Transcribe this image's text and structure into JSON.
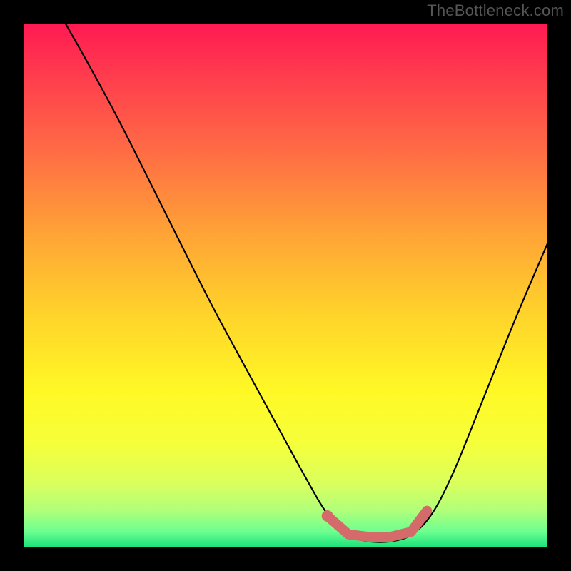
{
  "watermark": "TheBottleneck.com",
  "chart_data": {
    "type": "line",
    "title": "",
    "xlabel": "",
    "ylabel": "",
    "xlim": [
      0,
      100
    ],
    "ylim": [
      0,
      100
    ],
    "grid": false,
    "series": [
      {
        "name": "bottleneck-curve",
        "x": [
          8,
          12,
          18,
          24,
          30,
          36,
          42,
          48,
          54,
          58,
          62,
          66,
          70,
          74,
          78,
          82,
          86,
          90,
          94,
          100
        ],
        "y": [
          100,
          93,
          82,
          70,
          58,
          46,
          35,
          24,
          13,
          6,
          2,
          1,
          1,
          2,
          6,
          14,
          24,
          34,
          44,
          58
        ]
      }
    ],
    "highlight_segment": {
      "name": "optimal-range-marker",
      "color": "#d46a6a",
      "points": [
        {
          "x": 58,
          "y": 6
        },
        {
          "x": 62,
          "y": 2.5
        },
        {
          "x": 66,
          "y": 2
        },
        {
          "x": 70,
          "y": 2
        },
        {
          "x": 74,
          "y": 3
        },
        {
          "x": 77,
          "y": 7
        }
      ]
    },
    "highlight_dot": {
      "x": 58,
      "y": 6,
      "color": "#d46a6a"
    }
  }
}
